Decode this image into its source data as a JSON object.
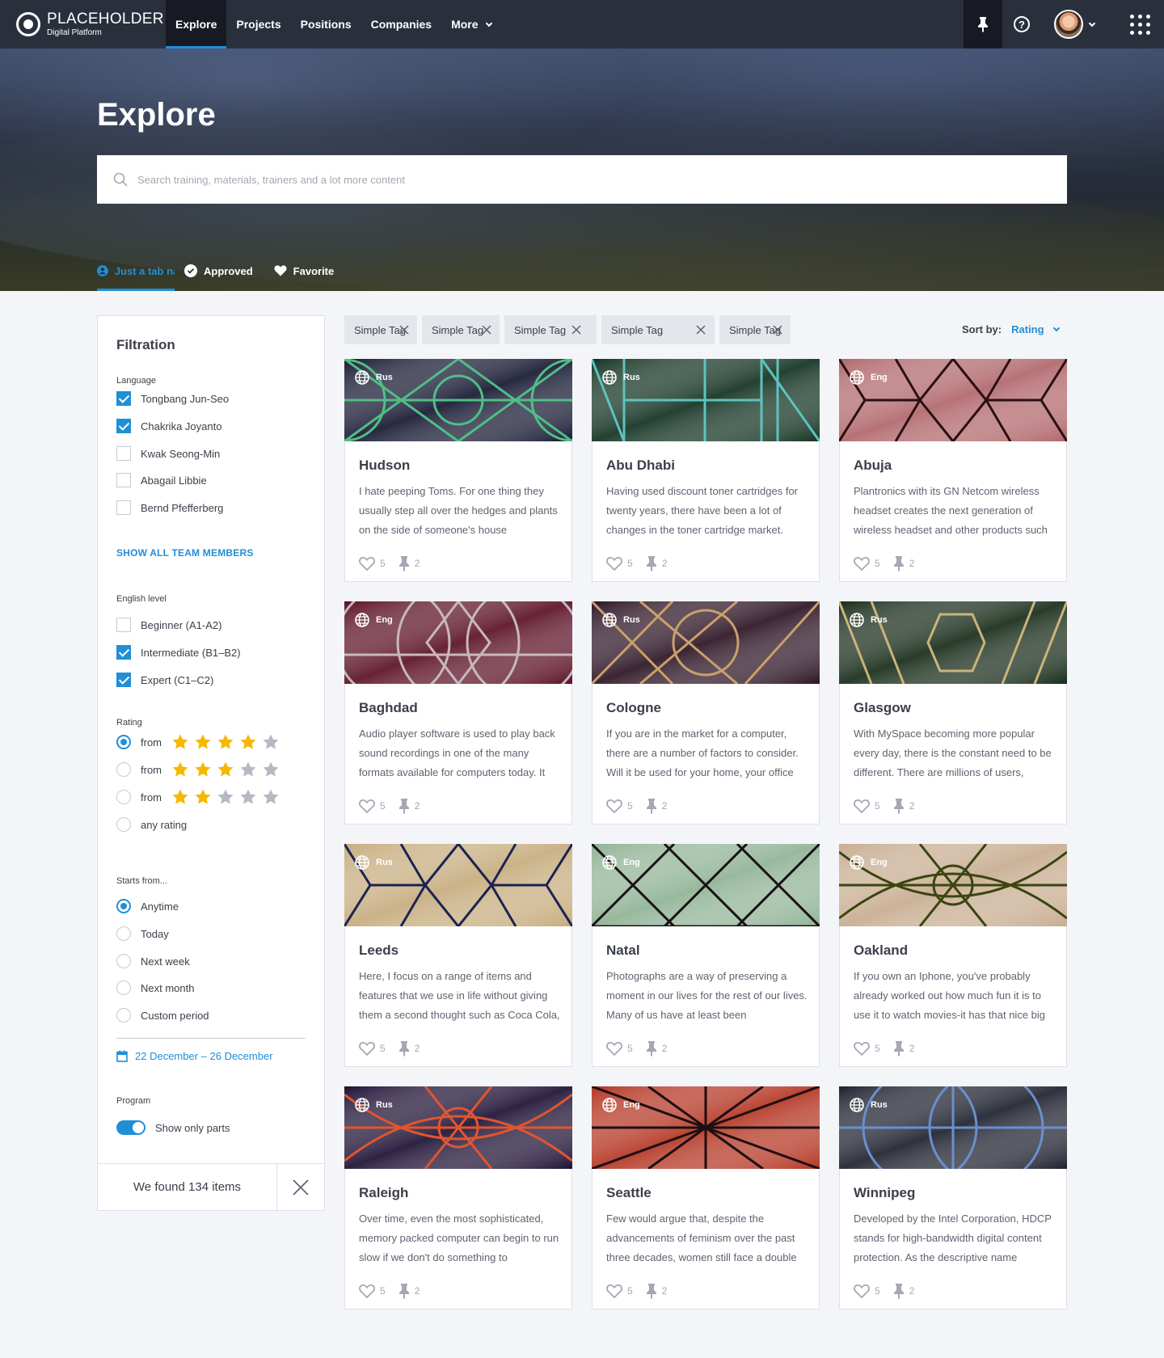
{
  "brand": {
    "title": "PLACEHOLDER",
    "subtitle": "Digital Platform"
  },
  "nav": {
    "items": [
      "Explore",
      "Projects",
      "Positions",
      "Companies",
      "More"
    ],
    "active": "Explore"
  },
  "hero": {
    "title": "Explore",
    "search_placeholder": "Search training, materials, trainers and a lot more content",
    "tabs": [
      {
        "label": "Just a tab name",
        "icon": "user-circle-icon",
        "active": true
      },
      {
        "label": "Approved",
        "icon": "check-circle-icon",
        "active": false
      },
      {
        "label": "Favorite",
        "icon": "heart-icon",
        "active": false
      }
    ]
  },
  "filters": {
    "title": "Filtration",
    "language": {
      "title": "Language",
      "options": [
        {
          "label": "Tongbang Jun-Seo",
          "checked": true
        },
        {
          "label": "Chakrika Joyanto",
          "checked": true
        },
        {
          "label": "Kwak Seong-Min",
          "checked": false
        },
        {
          "label": "Abagail Libbie",
          "checked": false
        },
        {
          "label": "Bernd Pfefferberg",
          "checked": false
        }
      ],
      "show_all": "SHOW ALL TEAM MEMBERS"
    },
    "english": {
      "title": "English level",
      "options": [
        {
          "label": "Beginner (A1-A2)",
          "checked": false
        },
        {
          "label": "Intermediate (B1–B2)",
          "checked": true
        },
        {
          "label": "Expert (C1–C2)",
          "checked": true
        }
      ]
    },
    "rating": {
      "title": "Rating",
      "options": [
        {
          "label": "from",
          "stars": 4,
          "selected": true
        },
        {
          "label": "from",
          "stars": 3,
          "selected": false
        },
        {
          "label": "from",
          "stars": 2,
          "selected": false
        },
        {
          "label": "any rating",
          "stars": 0,
          "selected": false
        }
      ]
    },
    "starts": {
      "title": "Starts from...",
      "options": [
        {
          "label": "Anytime",
          "selected": true
        },
        {
          "label": "Today",
          "selected": false
        },
        {
          "label": "Next week",
          "selected": false
        },
        {
          "label": "Next month",
          "selected": false
        },
        {
          "label": "Custom period",
          "selected": false
        }
      ],
      "date_range": "22 December – 26 December"
    },
    "program": {
      "title": "Program",
      "toggle_label": "Show only parts",
      "toggle_on": true
    },
    "found": "We found 134 items"
  },
  "tags": [
    "Simple Tag",
    "Simple Tag",
    "Simple Tag",
    "Simple Tag",
    "Simple Tag"
  ],
  "sort": {
    "label": "Sort by:",
    "value": "Rating"
  },
  "colors": {
    "accent": "#1f8fd6",
    "nav": "#2a2f3c",
    "star": "#f5b800"
  },
  "cards": [
    {
      "title": "Hudson",
      "lang": "Rus",
      "likes": "5",
      "pins": "2",
      "bg": "#141630",
      "line": "#4fbf86",
      "pattern": "circles",
      "desc": "I hate peeping Toms. For one thing they usually step all over the hedges and plants on the side of someone's house"
    },
    {
      "title": "Abu Dhabi",
      "lang": "Rus",
      "likes": "5",
      "pins": "2",
      "bg": "#10301f",
      "line": "#5bc4bf",
      "pattern": "boxes",
      "desc": "Having used discount toner cartridges for twenty years, there have been a lot of changes in the toner cartridge market."
    },
    {
      "title": "Abuja",
      "lang": "Eng",
      "likes": "5",
      "pins": "2",
      "bg": "#b0666a",
      "line": "#2a0f14",
      "pattern": "hex",
      "desc": "Plantronics with its GN Netcom wireless headset creates the next generation of wireless headset and other products such"
    },
    {
      "title": "Baghdad",
      "lang": "Eng",
      "likes": "5",
      "pins": "2",
      "bg": "#5a0f24",
      "line": "#c8b8be",
      "pattern": "arches",
      "desc": "Audio player software is used to play back sound recordings in one of the many formats available for computers today. It"
    },
    {
      "title": "Cologne",
      "lang": "Rus",
      "likes": "5",
      "pins": "2",
      "bg": "#2a1222",
      "line": "#caa06a",
      "pattern": "loops",
      "desc": "If you are in the market for a computer, there are a number of factors to consider. Will it be used for your home, your office"
    },
    {
      "title": "Glasgow",
      "lang": "Rus",
      "likes": "5",
      "pins": "2",
      "bg": "#162a18",
      "line": "#c9b57a",
      "pattern": "hexcenter",
      "desc": "With MySpace becoming more popular every day, there is the constant need to be different. There are millions of users,"
    },
    {
      "title": "Leeds",
      "lang": "Rus",
      "likes": "5",
      "pins": "2",
      "bg": "#c6ab7c",
      "line": "#1b2350",
      "pattern": "hex",
      "desc": "Here, I focus on a range of items and features that we use in life without giving them a second thought such as Coca Cola,"
    },
    {
      "title": "Natal",
      "lang": "Eng",
      "likes": "5",
      "pins": "2",
      "bg": "#8fb294",
      "line": "#1a1216",
      "pattern": "xs",
      "desc": "Photographs are a way of preserving a moment in our lives for the rest of our lives. Many of us have at least been"
    },
    {
      "title": "Oakland",
      "lang": "Eng",
      "likes": "5",
      "pins": "2",
      "bg": "#c7ab8f",
      "line": "#3a4510",
      "pattern": "eye",
      "desc": "If you own an Iphone, you've probably already worked out how much fun it is to use it to watch movies-it has that nice big"
    },
    {
      "title": "Raleigh",
      "lang": "Rus",
      "likes": "5",
      "pins": "2",
      "bg": "#1c0f33",
      "line": "#e2552e",
      "pattern": "eye",
      "desc": "Over time, even the most sophisticated, memory packed computer can begin to run slow if we don't do something to"
    },
    {
      "title": "Seattle",
      "lang": "Eng",
      "likes": "5",
      "pins": "2",
      "bg": "#b33320",
      "line": "#1d0e12",
      "pattern": "star",
      "desc": "Few would argue that, despite the advancements of feminism over the past three decades, women still face a double"
    },
    {
      "title": "Winnipeg",
      "lang": "Rus",
      "likes": "5",
      "pins": "2",
      "bg": "#1c202c",
      "line": "#6a8fd0",
      "pattern": "split",
      "desc": "Developed by the Intel Corporation, HDCP stands for high-bandwidth digital content protection. As the descriptive name"
    }
  ]
}
